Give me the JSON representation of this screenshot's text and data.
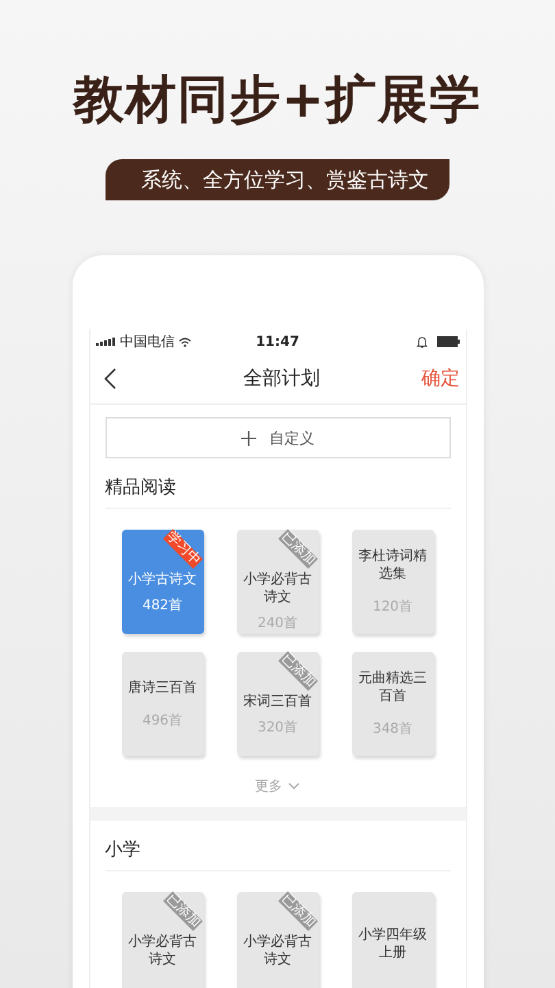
{
  "promo": {
    "headline": "教材同步+扩展学",
    "tagline": "系统、全方位学习、赏鉴古诗文"
  },
  "status_bar": {
    "carrier": "中国电信",
    "time": "11:47"
  },
  "nav": {
    "title": "全部计划",
    "action": "确定"
  },
  "custom_button": {
    "label": "自定义"
  },
  "sections": [
    {
      "title": "精品阅读",
      "more": "更多",
      "cards": [
        {
          "title": "小学古诗文",
          "count": "482首",
          "selected": true,
          "ribbon": {
            "kind": "learning",
            "text": "学习中"
          }
        },
        {
          "title": "小学必背古诗文",
          "count": "240首",
          "selected": false,
          "ribbon": {
            "kind": "added",
            "text": "已添加"
          }
        },
        {
          "title": "李杜诗词精选集",
          "count": "120首",
          "selected": false
        },
        {
          "title": "唐诗三百首",
          "count": "496首",
          "selected": false
        },
        {
          "title": "宋词三百首",
          "count": "320首",
          "selected": false,
          "ribbon": {
            "kind": "added",
            "text": "已添加"
          }
        },
        {
          "title": "元曲精选三百首",
          "count": "348首",
          "selected": false
        }
      ]
    },
    {
      "title": "小学",
      "cards": [
        {
          "title": "小学必背古诗文",
          "selected": false,
          "ribbon": {
            "kind": "added",
            "text": "已添加"
          }
        },
        {
          "title": "小学必背古诗文",
          "selected": false,
          "ribbon": {
            "kind": "added",
            "text": "已添加"
          }
        },
        {
          "title": "小学四年级上册",
          "selected": false
        }
      ]
    }
  ]
}
